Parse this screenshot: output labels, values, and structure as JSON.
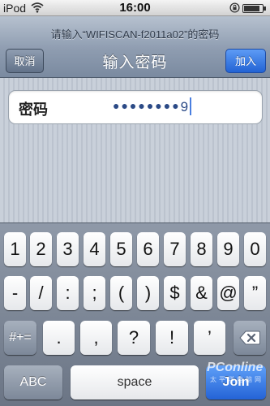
{
  "status_bar": {
    "carrier": "iPod",
    "time": "16:00",
    "wifi_icon": "wifi-icon",
    "rotation_lock_icon": "rotation-lock-icon",
    "battery_level": 0.85
  },
  "nav": {
    "prompt": "请输入“WIFISCAN-f2011a02”的密码",
    "title": "输入密码",
    "cancel_label": "取消",
    "join_label": "加入"
  },
  "password_field": {
    "label": "密码",
    "masked_chars": "●●●●●●●●",
    "last_char": "9"
  },
  "keyboard": {
    "row1": [
      "1",
      "2",
      "3",
      "4",
      "5",
      "6",
      "7",
      "8",
      "9",
      "0"
    ],
    "row2": [
      "-",
      "/",
      ":",
      ";",
      "(",
      ")",
      "$",
      "&",
      "@",
      "”"
    ],
    "row3_mode": "#+=",
    "row3": [
      ".",
      ",",
      "?",
      "!",
      "’"
    ],
    "abc_label": "ABC",
    "space_label": "space",
    "join_label": "Join"
  },
  "watermark": {
    "brand": "PConline",
    "sub": "太平洋电脑网"
  },
  "colors": {
    "accent_blue": "#2463d6",
    "nav_gray": "#8e9cb0",
    "keyboard_bg": "#7a8494"
  }
}
